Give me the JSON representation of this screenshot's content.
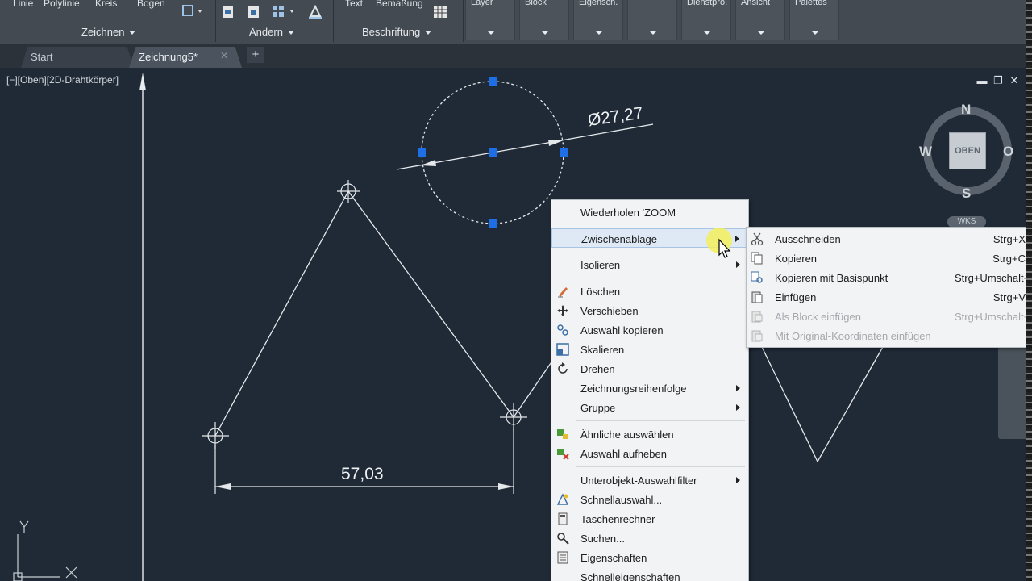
{
  "ribbon": {
    "top_labels": [
      "Linie",
      "Polylinie",
      "Kreis",
      "Bogen",
      "Text",
      "Bemaßung"
    ],
    "panels": [
      "Zeichnen",
      "Ändern",
      "Beschriftung"
    ],
    "dropdowns": [
      "Layer",
      "Block",
      "Eigensch.",
      "",
      "Dienstpro.",
      "Ansicht",
      "Palettes"
    ]
  },
  "tabs": {
    "start": "Start",
    "drawing": "Zeichnung5*",
    "close": "✕",
    "add": "+"
  },
  "viewport": {
    "label": "[−][Oben][2D-Drahtkörper]",
    "minimize": "▬",
    "restore": "❐",
    "close": "✕"
  },
  "drawing": {
    "dim_diameter": "Ø27,27",
    "dim_linear": "57,03",
    "ucs_y": "Y",
    "ucs_x": "X"
  },
  "viewcube": {
    "north": "N",
    "south": "S",
    "west": "W",
    "east": "O",
    "top": "OBEN",
    "wcs": "WKS"
  },
  "context_menu": {
    "items": [
      {
        "label": "Wiederholen 'ZOOM",
        "icon": "",
        "submenu": false
      },
      {
        "label": "Zwischenablage",
        "icon": "",
        "submenu": true,
        "highlighted": true
      },
      {
        "label": "Isolieren",
        "icon": "",
        "submenu": true
      },
      {
        "label": "Löschen",
        "icon": "eraser-icon",
        "submenu": false
      },
      {
        "label": "Verschieben",
        "icon": "move-icon",
        "submenu": false
      },
      {
        "label": "Auswahl kopieren",
        "icon": "copy-selection-icon",
        "submenu": false
      },
      {
        "label": "Skalieren",
        "icon": "scale-icon",
        "submenu": false
      },
      {
        "label": "Drehen",
        "icon": "rotate-icon",
        "submenu": false
      },
      {
        "label": "Zeichnungsreihenfolge",
        "icon": "",
        "submenu": true
      },
      {
        "label": "Gruppe",
        "icon": "",
        "submenu": true
      },
      {
        "label": "Ähnliche auswählen",
        "icon": "select-similar-icon",
        "submenu": false
      },
      {
        "label": "Auswahl aufheben",
        "icon": "deselect-icon",
        "submenu": false
      },
      {
        "label": "Unterobjekt-Auswahlfilter",
        "icon": "",
        "submenu": true
      },
      {
        "label": "Schnellauswahl...",
        "icon": "quick-select-icon",
        "submenu": false
      },
      {
        "label": "Taschenrechner",
        "icon": "calculator-icon",
        "submenu": false
      },
      {
        "label": "Suchen...",
        "icon": "find-icon",
        "submenu": false
      },
      {
        "label": "Eigenschaften",
        "icon": "properties-icon",
        "submenu": false
      },
      {
        "label": "Schnelleigenschaften",
        "icon": "",
        "submenu": false
      }
    ]
  },
  "clipboard_submenu": {
    "items": [
      {
        "label": "Ausschneiden",
        "shortcut": "Strg+X",
        "icon": "scissors-icon",
        "enabled": true
      },
      {
        "label": "Kopieren",
        "shortcut": "Strg+C",
        "icon": "copy-icon",
        "enabled": true
      },
      {
        "label": "Kopieren mit Basispunkt",
        "shortcut": "Strg+Umschalt+C",
        "icon": "copy-basepoint-icon",
        "enabled": true
      },
      {
        "label": "Einfügen",
        "shortcut": "Strg+V",
        "icon": "paste-icon",
        "enabled": true
      },
      {
        "label": "Als Block einfügen",
        "shortcut": "Strg+Umschalt+V",
        "icon": "paste-block-icon",
        "enabled": false
      },
      {
        "label": "Mit Original-Koordinaten einfügen",
        "shortcut": "",
        "icon": "paste-orig-icon",
        "enabled": false
      }
    ]
  }
}
